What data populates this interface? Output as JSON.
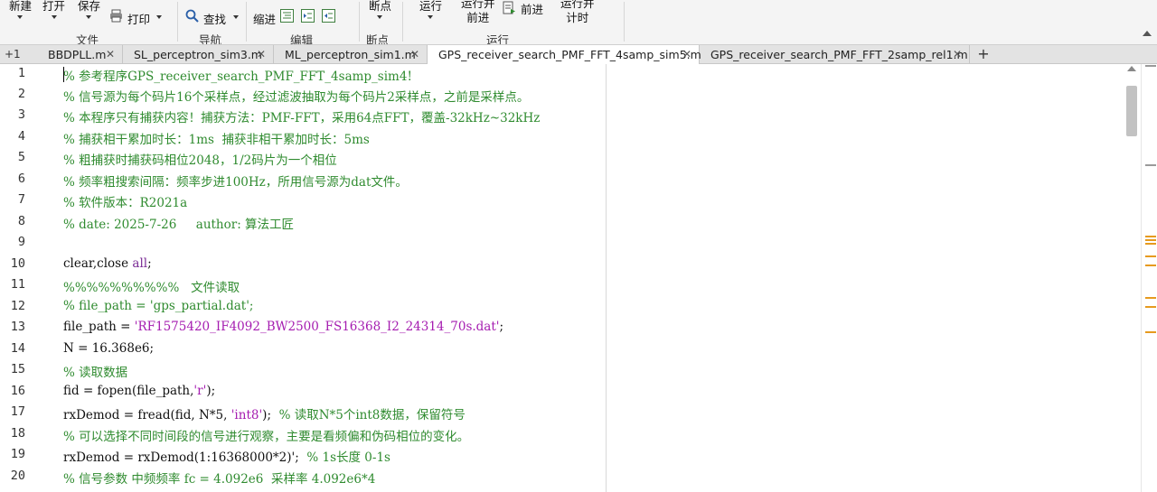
{
  "toolstrip": {
    "file_section": {
      "label": "文件",
      "new_label": "新建",
      "open_label": "打开",
      "save_label": "保存",
      "print_label": "打印"
    },
    "navigate_section": {
      "label": "导航",
      "find_label": "查找"
    },
    "edit_section": {
      "label": "编辑",
      "indent_label": "缩进"
    },
    "breakpoint_section": {
      "label": "断点",
      "breakpoint_label": "断点"
    },
    "run_section": {
      "label": "运行",
      "run_label": "运行",
      "run_advance_line1": "运行并",
      "run_advance_line2": "前进",
      "advance_label": "前进",
      "run_time_line1": "运行并",
      "run_time_line2": "计时"
    }
  },
  "tabs": {
    "overflow_label": "+1",
    "items": [
      {
        "label": "BBDPLL.m",
        "active": false,
        "close": "✕"
      },
      {
        "label": "SL_perceptron_sim3.m",
        "active": false,
        "close": "✕"
      },
      {
        "label": "ML_perceptron_sim1.m",
        "active": false,
        "close": "✕"
      },
      {
        "label": "GPS_receiver_search_PMF_FFT_4samp_sim5.m",
        "active": true,
        "close": "✕"
      },
      {
        "label": "GPS_receiver_search_PMF_FFT_2samp_rel1.m",
        "active": false,
        "close": "✕"
      }
    ],
    "new_tab_label": "+"
  },
  "editor": {
    "line_numbers": [
      "1",
      "2",
      "3",
      "4",
      "5",
      "6",
      "7",
      "8",
      "9",
      "10",
      "11",
      "12",
      "13",
      "14",
      "15",
      "16",
      "17",
      "18",
      "19",
      "20"
    ],
    "lines": {
      "l1": "% 参考程序GPS_receiver_search_PMF_FFT_4samp_sim4!",
      "l2": "% 信号源为每个码片16个采样点，经过滤波抽取为每个码片2采样点，之前是采样点。",
      "l3": "% 本程序只有捕获内容！捕获方法：PMF-FFT，采用64点FFT，覆盖-32kHz~32kHz",
      "l4": "% 捕获相干累加时长：1ms  捕获非相干累加时长：5ms",
      "l5": "% 粗捕获时捕获码相位2048，1/2码片为一个相位",
      "l6": "% 频率粗搜索间隔：频率步进100Hz，所用信号源为dat文件。",
      "l7": "% 软件版本：R2021a",
      "l8": "% date: 2025-7-26     author: 算法工匠",
      "l9": "",
      "l10_a": "clear,close ",
      "l10_b": "all",
      "l10_c": ";",
      "l11": "%%%%%%%%%%   文件读取",
      "l12": "% file_path = 'gps_partial.dat';",
      "l13_a": "file_path = ",
      "l13_b": "'RF1575420_IF4092_BW2500_FS16368_I2_24314_70s.dat'",
      "l13_c": ";",
      "l14": "N = 16.368e6;",
      "l15": "% 读取数据",
      "l16_a": "fid = fopen(file_path,",
      "l16_b": "'r'",
      "l16_c": ");",
      "l17_a": "rxDemod = fread(fid, N*5, ",
      "l17_b": "'int8'",
      "l17_c": ");  ",
      "l17_d": "% 读取N*5个int8数据，保留符号",
      "l18": "% 可以选择不同时间段的信号进行观察，主要是看频偏和伪码相位的变化。",
      "l19_a": "rxDemod = rxDemod(1:16368000*2)';  ",
      "l19_b": "% 1s长度 0-1s",
      "l20": "% 信号参数 中频频率 fc = 4.092e6  采样率 4.092e6*4"
    }
  },
  "colors": {
    "comment": "#2f8b2f",
    "string": "#a51cb0",
    "keyword": "#7a2b95",
    "marker": "#e69a1e"
  }
}
